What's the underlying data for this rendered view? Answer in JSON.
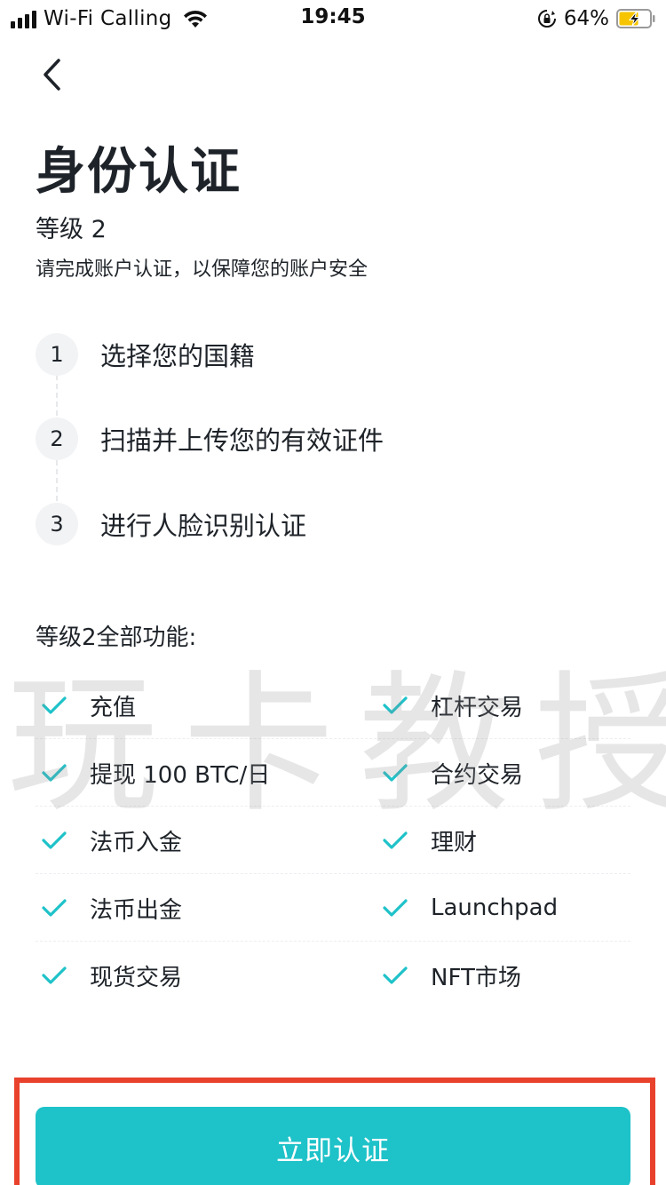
{
  "status_bar": {
    "carrier": "Wi-Fi Calling",
    "time": "19:45",
    "battery_percent": "64%",
    "battery_level": 0.64,
    "icons": [
      "signal-icon",
      "wifi-icon",
      "orientation-lock-icon",
      "battery-charging-icon"
    ]
  },
  "header": {
    "back_icon": "chevron-left-icon",
    "title": "身份认证",
    "level": "等级 2",
    "subtitle": "请完成账户认证，以保障您的账户安全"
  },
  "steps": [
    {
      "number": "1",
      "label": "选择您的国籍"
    },
    {
      "number": "2",
      "label": "扫描并上传您的有效证件"
    },
    {
      "number": "3",
      "label": "进行人脸识别认证"
    }
  ],
  "features": {
    "title": "等级2全部功能:",
    "check_icon": "check-icon",
    "check_color": "#1ec2c9",
    "rows": [
      [
        "充值",
        "杠杆交易"
      ],
      [
        "提现 100 BTC/日",
        "合约交易"
      ],
      [
        "法币入金",
        "理财"
      ],
      [
        "法币出金",
        "Launchpad"
      ],
      [
        "现货交易",
        "NFT市场"
      ]
    ]
  },
  "watermark": "玩卡教授",
  "cta": {
    "label": "立即认证",
    "color": "#1ec2c9",
    "highlight_color": "#e8412c"
  }
}
